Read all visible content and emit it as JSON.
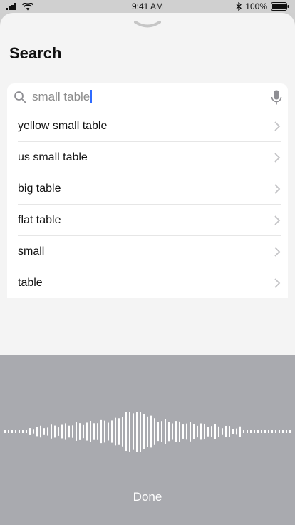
{
  "status_bar": {
    "time": "9:41 AM",
    "battery": "100%"
  },
  "sheet": {
    "title": "Search"
  },
  "search": {
    "query": "small table"
  },
  "suggestions": [
    {
      "label": "yellow small table"
    },
    {
      "label": "us small table"
    },
    {
      "label": "big table"
    },
    {
      "label": "flat table"
    },
    {
      "label": "small"
    },
    {
      "label": "table"
    }
  ],
  "voice": {
    "done_label": "Done"
  }
}
